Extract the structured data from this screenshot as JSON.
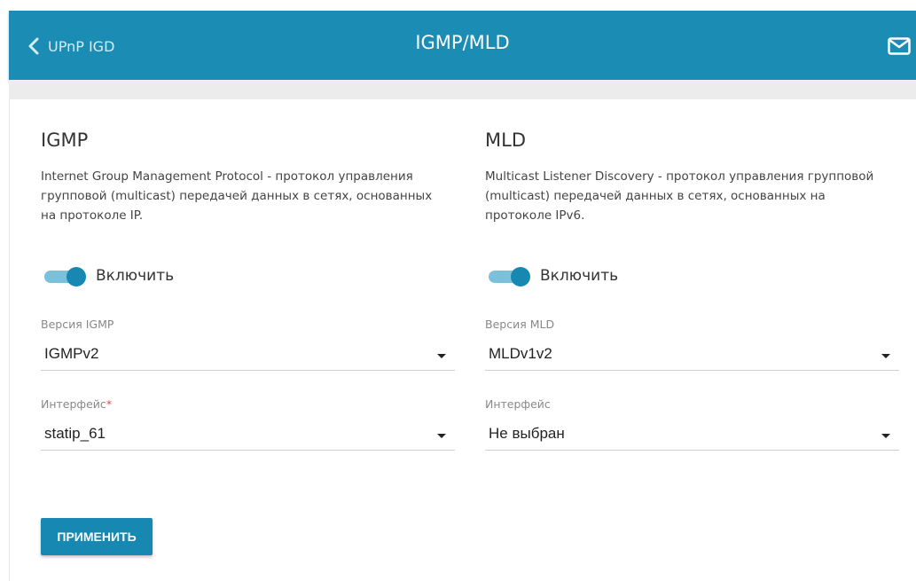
{
  "header": {
    "back_label": "UPnP IGD",
    "title": "IGMP/MLD"
  },
  "igmp": {
    "title": "IGMP",
    "description": "Internet Group Management Protocol - протокол управления групповой (multicast) передачей данных в сетях, основанных на протоколе IP.",
    "enable_label": "Включить",
    "enabled": true,
    "version_label": "Версия IGMP",
    "version_value": "IGMPv2",
    "interface_label": "Интерфейс",
    "interface_required_mark": "*",
    "interface_value": "statip_61"
  },
  "mld": {
    "title": "MLD",
    "description": "Multicast Listener Discovery - протокол управления групповой (multicast) передачей данных в сетях, основанных на протоколе IPv6.",
    "enable_label": "Включить",
    "enabled": true,
    "version_label": "Версия MLD",
    "version_value": "MLDv1v2",
    "interface_label": "Интерфейс",
    "interface_value": "Не выбран"
  },
  "apply_label": "ПРИМЕНИТЬ",
  "icons": {
    "back": "chevron-left-icon",
    "mail": "mail-icon",
    "dropdown": "caret-down-icon"
  },
  "colors": {
    "primary": "#1b8db4",
    "toggle_track": "#7cc1db",
    "toggle_knob": "#1688b2",
    "required": "#e04b4b"
  }
}
